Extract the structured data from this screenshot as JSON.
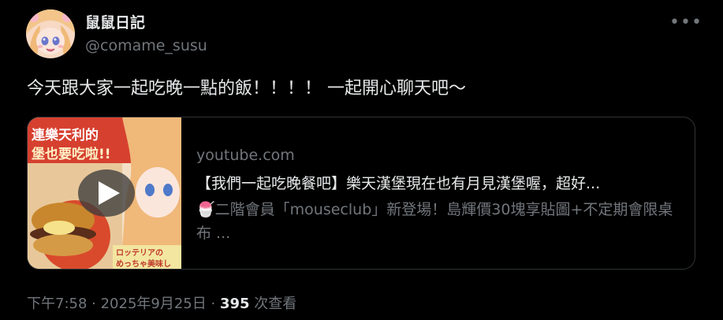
{
  "author": {
    "display_name": "鼠鼠日記",
    "handle": "@comame_susu"
  },
  "tweet": {
    "text": "今天跟大家一起吃晚一點的飯！！！！ 一起開心聊天吧～"
  },
  "card": {
    "domain": "youtube.com",
    "title": "【我們一起吃晚餐吧】樂天漢堡現在也有月見漢堡喔，超好...",
    "description_emoji": "🍧",
    "description": "二階會員「mouseclub」新登場！島輝價30塊享貼圖+不定期會限桌布 ...",
    "thumbnail_text_top": "連樂天利的",
    "thumbnail_text_mid": "堡也要吃啦!!",
    "thumbnail_text_sign": "ロッテリアの",
    "thumbnail_text_bottom": "めっちゃ美味し"
  },
  "meta": {
    "time": "下午7:58",
    "separator": " · ",
    "date": "2025年9月25日",
    "views_count": "395",
    "views_label": " 次查看"
  },
  "icons": {
    "more": "more-horizontal-icon",
    "play": "play-icon"
  },
  "colors": {
    "background": "#000000",
    "text": "#e7e9ea",
    "secondary": "#71767b",
    "border": "#2f3336"
  }
}
